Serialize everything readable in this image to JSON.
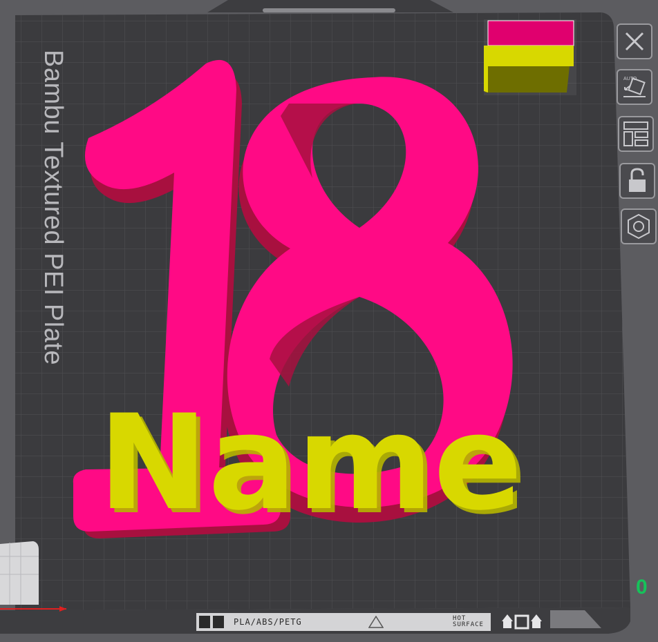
{
  "plate": {
    "label": "Bambu Textured PEI Plate",
    "filament_tag": "PLA/ABS/PETG",
    "hot_line1": "HOT",
    "hot_line2": "SURFACE"
  },
  "model": {
    "number_text": "18",
    "name_text": "Name",
    "colors": {
      "primary": "#ff0a85",
      "primary_side": "#a8103f",
      "secondary": "#d8d800",
      "secondary_dark": "#6e6e00"
    }
  },
  "toolbar": {
    "buttons": [
      {
        "icon": "close-icon"
      },
      {
        "icon": "auto-orient-icon",
        "badge": "AUTO"
      },
      {
        "icon": "arrange-icon"
      },
      {
        "icon": "lock-icon"
      },
      {
        "icon": "settings-hex-icon"
      }
    ]
  },
  "status": {
    "coordinate_partial": "0"
  },
  "colors": {
    "background": "#5c5c60",
    "plate": "#3a3a3c",
    "grid": "#4f4f52"
  }
}
